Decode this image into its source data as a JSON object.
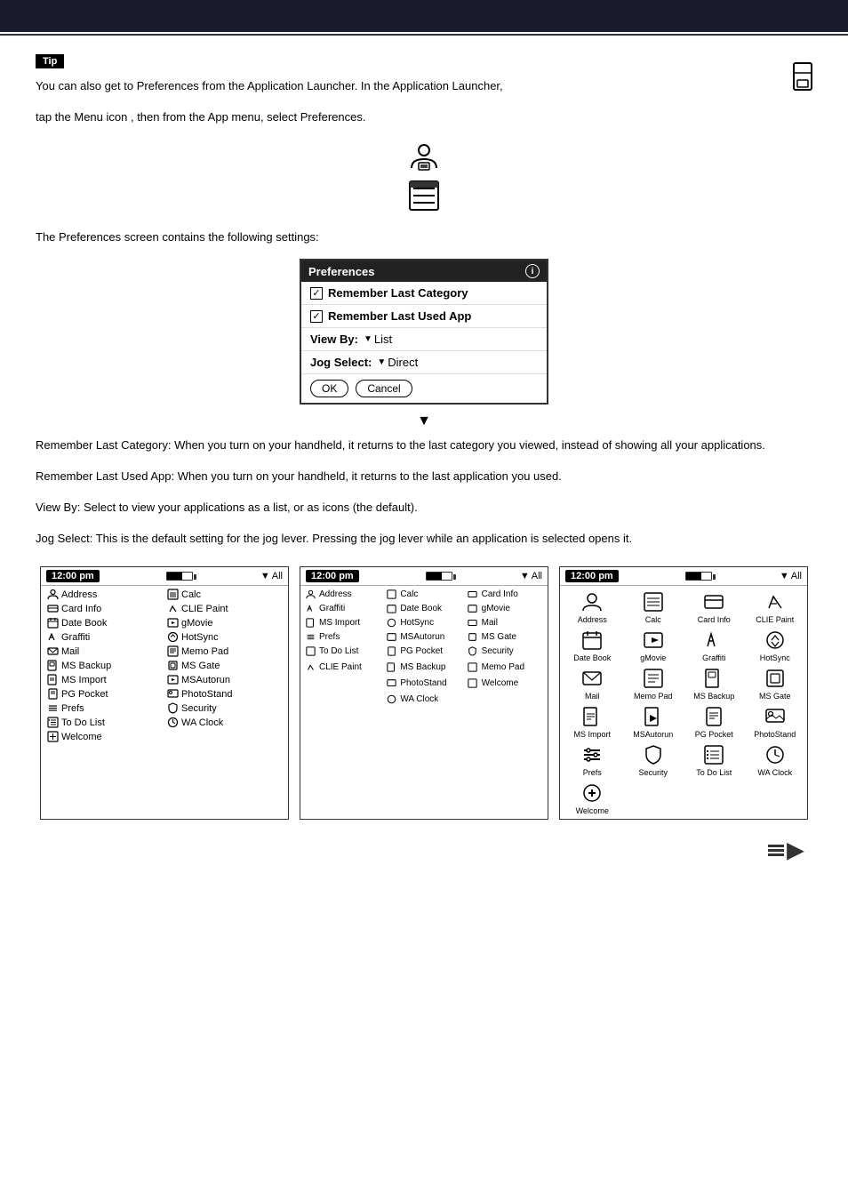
{
  "header": {
    "title": ""
  },
  "tip": {
    "label": "Tip"
  },
  "sections": [
    {
      "id": "s1",
      "text": "You can also get to Preferences from the Application Launcher. In the Application Launcher,"
    },
    {
      "id": "s2",
      "text": "tap the Menu icon"
    },
    {
      "id": "s3",
      "text": ", then from the App menu, select Preferences."
    },
    {
      "id": "s4",
      "text": "The Preferences screen contains the following settings:"
    },
    {
      "id": "s5",
      "text": "Remember Last Category: When you turn on your handheld, it returns to the last category you viewed, instead of showing all your applications."
    },
    {
      "id": "s6",
      "text": "Remember Last Used App: When you turn on your handheld, it returns to the last application you used."
    },
    {
      "id": "s7",
      "text": "View By: Select to view your applications as a list, or as icons (the default)."
    },
    {
      "id": "s8",
      "text": "Jog Select: This is the default setting for the jog lever. Pressing the jog lever while an application is selected opens it."
    }
  ],
  "preferences_dialog": {
    "title": "Preferences",
    "info_icon": "i",
    "rows": [
      {
        "checked": true,
        "label": "Remember Last Category"
      },
      {
        "checked": true,
        "label": "Remember Last Used App"
      },
      {
        "label_prefix": "View By:",
        "value": "List",
        "has_dropdown": true
      },
      {
        "label_prefix": "Jog Select:",
        "value": "Direct",
        "has_dropdown": true
      }
    ],
    "ok_label": "OK",
    "cancel_label": "Cancel"
  },
  "down_arrow": "▼",
  "screens": [
    {
      "id": "screen1",
      "time": "12:00 pm",
      "category": "▼ All",
      "view": "list",
      "two_columns": true,
      "apps_col1": [
        {
          "name": "Address",
          "icon": "address"
        },
        {
          "name": "Card Info",
          "icon": "cardinfo"
        },
        {
          "name": "Date Book",
          "icon": "datebook"
        },
        {
          "name": "Graffiti",
          "icon": "graffiti"
        },
        {
          "name": "Mail",
          "icon": "mail"
        },
        {
          "name": "MS Backup",
          "icon": "msbackup"
        },
        {
          "name": "MS Import",
          "icon": "msimport"
        },
        {
          "name": "PG Pocket",
          "icon": "pgpocket"
        },
        {
          "name": "Prefs",
          "icon": "prefs"
        },
        {
          "name": "To Do List",
          "icon": "todolist"
        },
        {
          "name": "Welcome",
          "icon": "welcome"
        }
      ],
      "apps_col2": [
        {
          "name": "Calc",
          "icon": "calc"
        },
        {
          "name": "CLIE Paint",
          "icon": "cliepaint"
        },
        {
          "name": "gMovie",
          "icon": "gmovie"
        },
        {
          "name": "HotSync",
          "icon": "hotsync"
        },
        {
          "name": "Memo Pad",
          "icon": "memopad"
        },
        {
          "name": "MS Gate",
          "icon": "msgate"
        },
        {
          "name": "MSAutorun",
          "icon": "msautorun"
        },
        {
          "name": "PhotoStand",
          "icon": "photostand"
        },
        {
          "name": "Security",
          "icon": "security"
        },
        {
          "name": "WA Clock",
          "icon": "waclock"
        }
      ]
    },
    {
      "id": "screen2",
      "time": "12:00 pm",
      "category": "▼ All",
      "view": "list_small",
      "apps_col1": [
        {
          "name": "Address",
          "icon": "address"
        },
        {
          "name": "Graffiti",
          "icon": "graffiti"
        },
        {
          "name": "MS Import",
          "icon": "msimport"
        },
        {
          "name": "Prefs",
          "icon": "prefs"
        },
        {
          "name": "To Do List",
          "icon": "todolist"
        }
      ],
      "apps_col2": [
        {
          "name": "Calc",
          "icon": "calc"
        },
        {
          "name": "Date Book",
          "icon": "datebook"
        },
        {
          "name": "HotSync",
          "icon": "hotsync"
        },
        {
          "name": "MSAutorun",
          "icon": "msautorun"
        },
        {
          "name": "PG Pocket",
          "icon": "pgpocket"
        }
      ],
      "apps_col3": [
        {
          "name": "Card Info",
          "icon": "cardinfo"
        },
        {
          "name": "gMovie",
          "icon": "gmovie"
        },
        {
          "name": "Mail",
          "icon": "mail"
        },
        {
          "name": "MS Gate",
          "icon": "msgate"
        },
        {
          "name": "Security",
          "icon": "security"
        }
      ],
      "apps_col4": [
        {
          "name": "CLIE Paint",
          "icon": "cliepaint"
        },
        {
          "name": "MS Backup",
          "icon": "msbackup"
        },
        {
          "name": "Memo Pad",
          "icon": "memopad"
        },
        {
          "name": "PhotoStand",
          "icon": "photostand"
        },
        {
          "name": "Welcome",
          "icon": "welcome"
        }
      ]
    },
    {
      "id": "screen3",
      "time": "12:00 pm",
      "category": "▼ All",
      "view": "icons",
      "icon_apps": [
        {
          "name": "Address"
        },
        {
          "name": "Calc"
        },
        {
          "name": "Card Info"
        },
        {
          "name": "CLIE Paint"
        },
        {
          "name": "Date Book"
        },
        {
          "name": "gMovie"
        },
        {
          "name": "Graffiti"
        },
        {
          "name": "HotSync"
        },
        {
          "name": "Mail"
        },
        {
          "name": "Memo Pad"
        },
        {
          "name": "MS Backup"
        },
        {
          "name": "MS Gate"
        },
        {
          "name": "MS Import"
        },
        {
          "name": "MSAutorun"
        },
        {
          "name": "PG Pocket"
        },
        {
          "name": "PhotoStand"
        },
        {
          "name": "Prefs"
        },
        {
          "name": "Security"
        },
        {
          "name": "To Do List"
        },
        {
          "name": "WA Clock"
        },
        {
          "name": "Welcome"
        }
      ]
    }
  ],
  "memory_stick_icon_label": "Memory Stick card",
  "icons": {
    "icon1_label": "Application Preferences icon",
    "icon2_label": "Menu icon"
  }
}
